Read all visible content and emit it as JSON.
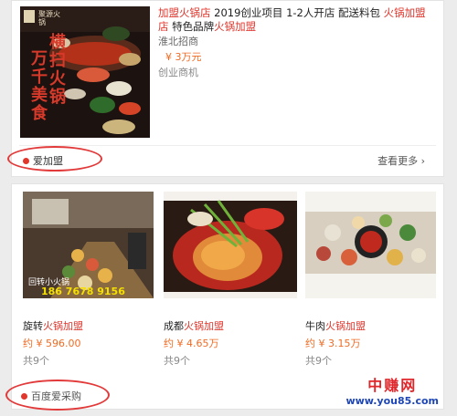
{
  "result1": {
    "title_parts": [
      "加盟火锅店",
      " 2019创业项目 1-2人开店 配送料包 ",
      "火锅加盟店",
      " 特色品牌",
      "火锅加盟"
    ],
    "company": "淮北招商",
    "price": "¥ 3万元",
    "tag": "创业商机",
    "image_text": {
      "brand": "聚源火锅",
      "slogan_line1": "横扫火锅",
      "slogan_line2": "万千美食"
    }
  },
  "source1": {
    "label": "爱加盟",
    "more": "查看更多",
    "more_chevron": "›"
  },
  "products": [
    {
      "name_plain": "旋转",
      "name_hl": "火锅加盟",
      "price": "约 ¥ 596.00",
      "count": "共9个",
      "image_text_brand": "回转小火锅",
      "image_text_phone": "186 7678 9156"
    },
    {
      "name_plain": "成都",
      "name_hl": "火锅加盟",
      "price": "约 ¥ 4.65万",
      "count": "共9个"
    },
    {
      "name_plain": "牛肉",
      "name_hl": "火锅加盟",
      "price": "约 ¥ 3.15万",
      "count": "共9个"
    }
  ],
  "source2": {
    "label": "百度爱采购"
  },
  "watermark": {
    "title": "中赚网",
    "url": "www.you85.com"
  },
  "colors": {
    "highlight": "#e0362c",
    "price": "#f06b23",
    "annotation": "#e23a3a"
  }
}
